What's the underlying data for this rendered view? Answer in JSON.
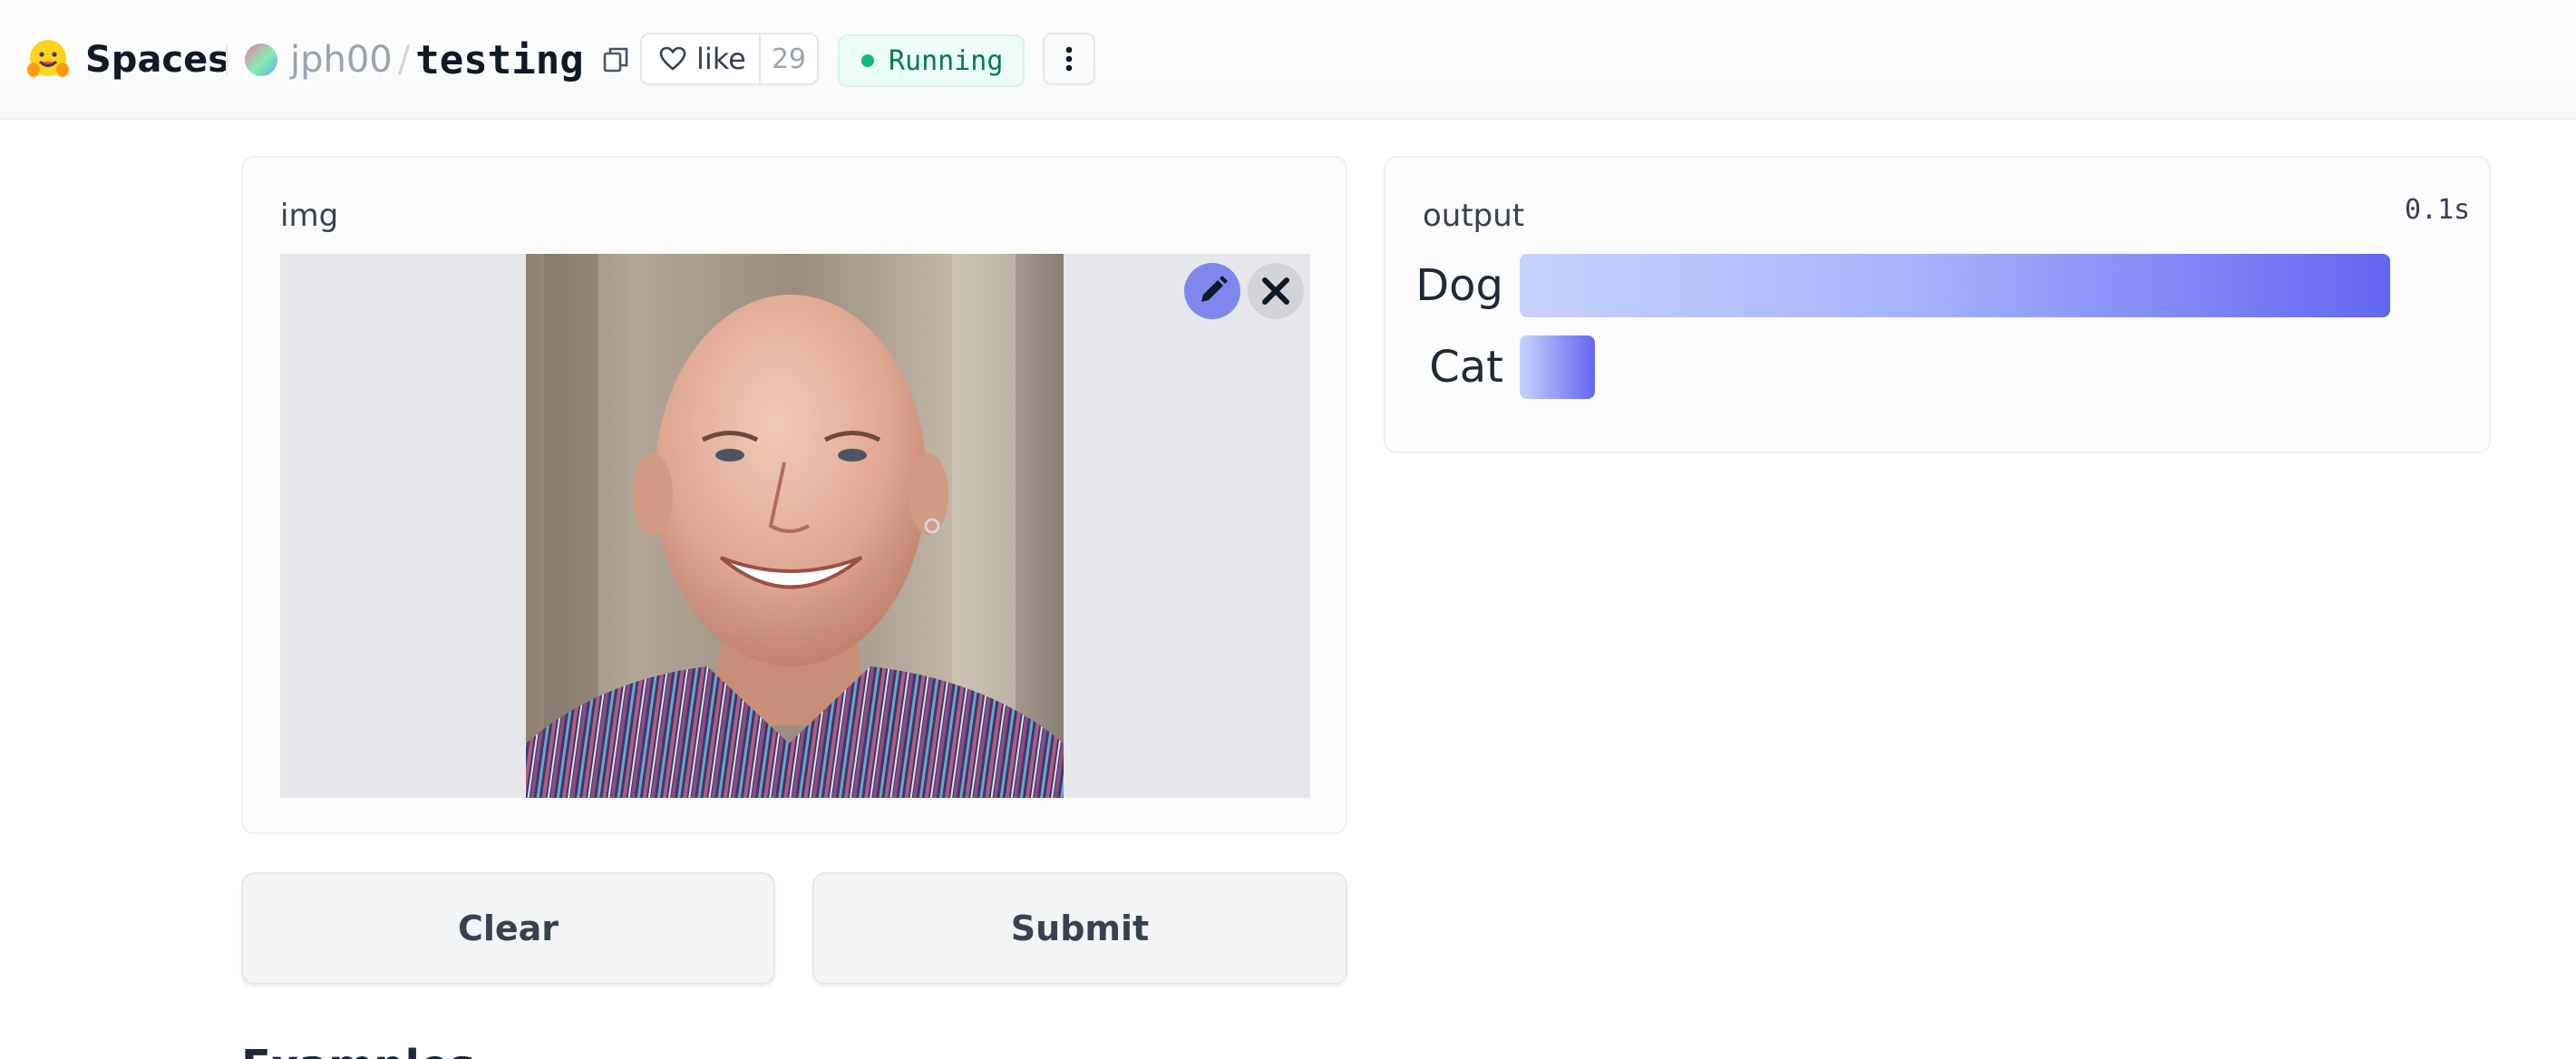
{
  "header": {
    "brand": "Spaces",
    "owner": "jph00",
    "separator": "/",
    "repo": "testing",
    "like_label": "like",
    "like_count": "29",
    "status": "Running"
  },
  "input": {
    "label": "img",
    "photo_subject": "portrait of a smiling bald man in a striped shirt",
    "edit_icon": "pencil-icon",
    "remove_icon": "close-icon"
  },
  "output": {
    "label": "output",
    "timer": "0.1s",
    "confidences": [
      {
        "label": "Dog",
        "fraction": 0.98
      },
      {
        "label": "Cat",
        "fraction": 0.085
      }
    ]
  },
  "actions": {
    "clear": "Clear",
    "submit": "Submit"
  },
  "examples": {
    "heading": "Examples"
  },
  "colors": {
    "accent": "#6366f1",
    "bar_light": "#c7d2fe",
    "status_green": "#10b981"
  }
}
